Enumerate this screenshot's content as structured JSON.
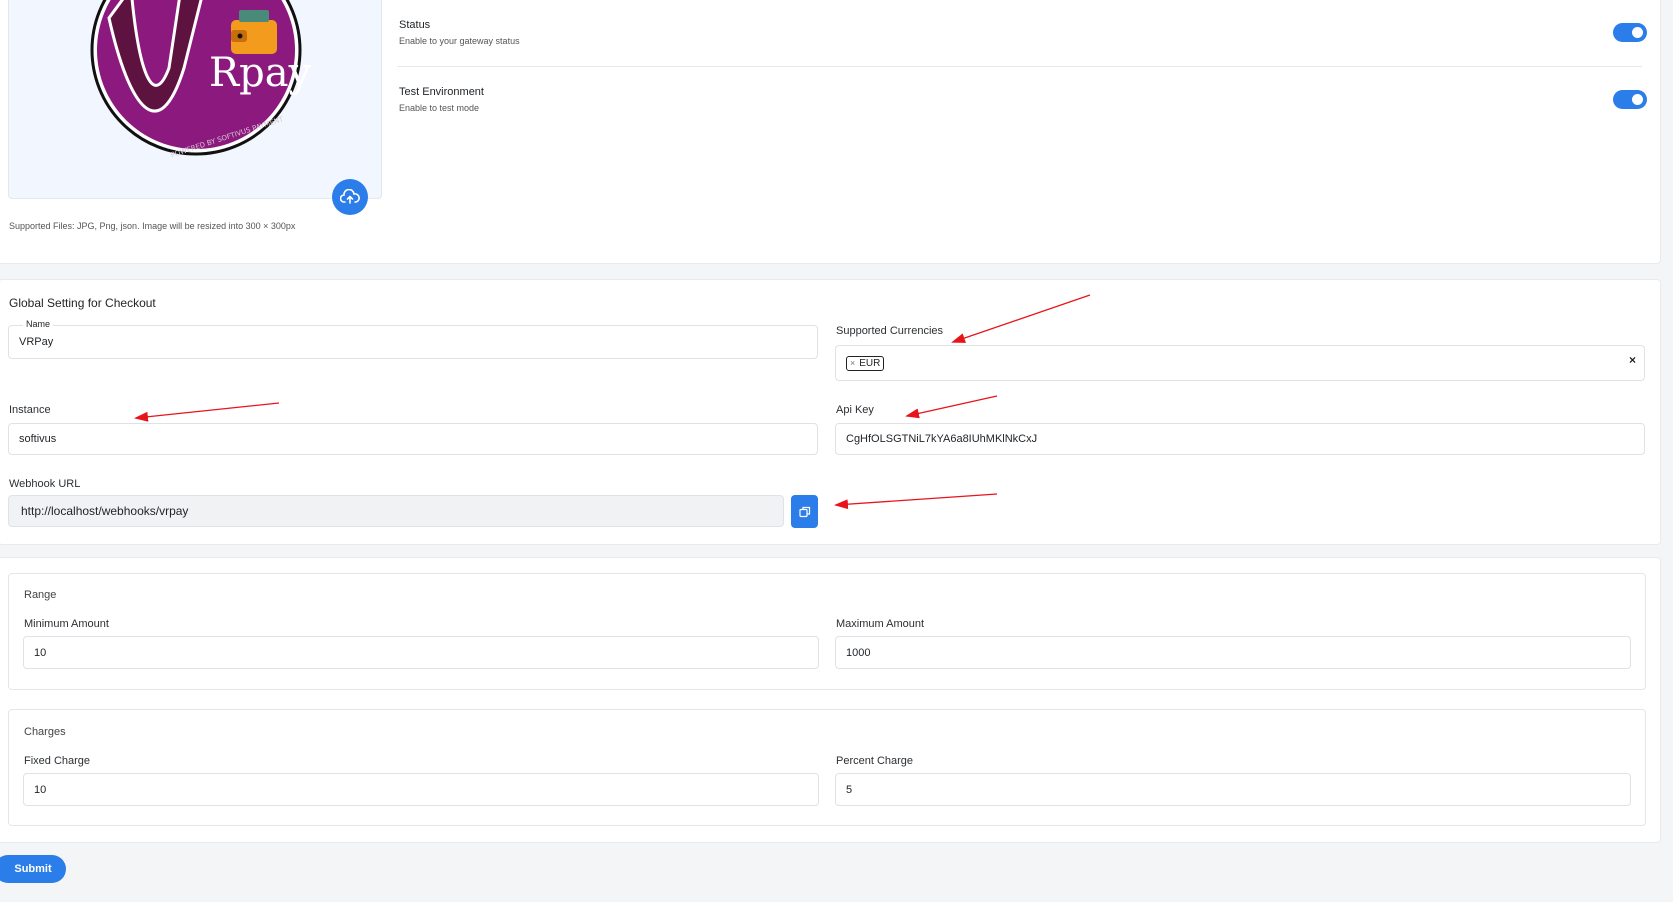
{
  "gateway": {
    "logo_text": "Rpay",
    "upload_hint": "Supported Files: JPG, Png, json. Image will be resized into 300 × 300px",
    "status_title": "Status",
    "status_desc": "Enable to your gateway status",
    "test_title": "Test Environment",
    "test_desc": "Enable to test mode"
  },
  "checkout": {
    "section_title": "Global Setting for Checkout",
    "name_label": "Name",
    "name_value": "VRPay",
    "currencies_label": "Supported Currencies",
    "currency_tag": "EUR",
    "instance_label": "Instance",
    "instance_value": "softivus",
    "apikey_label": "Api Key",
    "apikey_value": "CgHfOLSGTNiL7kYA6a8IUhMKlNkCxJ",
    "webhook_label": "Webhook URL",
    "webhook_value": "http://localhost/webhooks/vrpay"
  },
  "range": {
    "title": "Range",
    "min_label": "Minimum Amount",
    "min_value": "10",
    "max_label": "Maximum Amount",
    "max_value": "1000"
  },
  "charges": {
    "title": "Charges",
    "fixed_label": "Fixed Charge",
    "fixed_value": "10",
    "percent_label": "Percent Charge",
    "percent_value": "5"
  },
  "submit_label": "Submit",
  "colors": {
    "accent": "#2b7de9",
    "annotation": "#e8141b",
    "logo_purple": "#8c1a7e"
  }
}
